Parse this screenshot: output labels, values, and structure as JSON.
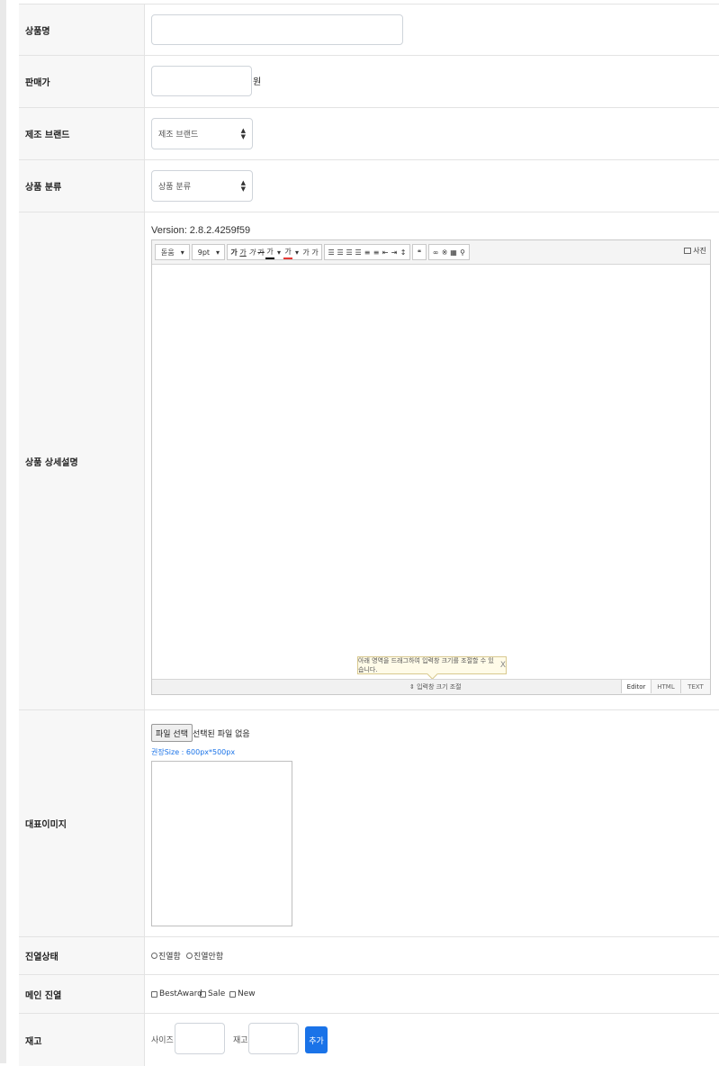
{
  "form": {
    "product_name": {
      "label": "상품명",
      "value": ""
    },
    "price": {
      "label": "판매가",
      "value": "",
      "unit": "원"
    },
    "brand": {
      "label": "제조 브랜드",
      "selected": "제조 브랜드"
    },
    "category": {
      "label": "상품 분류",
      "selected": "상품 분류"
    },
    "description": {
      "label": "상품 상세설명",
      "version": "Version: 2.8.2.4259f59",
      "toolbar": {
        "font": "돋움",
        "size": "9pt",
        "bold": "가",
        "underline": "가",
        "italic": "가",
        "strike": "가",
        "text_color": "가",
        "bg_color": "가",
        "superscript": "가",
        "subscript": "가",
        "quote": "❝",
        "photo": "사진"
      },
      "resize_tip": "아래 영역을 드래그하여 입력창 크기를 조절할 수 있습니다.",
      "resize_tip_close": "X",
      "resize_label": "⇕ 입력창 크기 조절",
      "modes": [
        "Editor",
        "HTML",
        "TEXT"
      ]
    },
    "image": {
      "label": "대표이미지",
      "button": "파일 선택",
      "status": "선택된 파일 없음",
      "size_note": "권장Size : 600px*500px"
    },
    "display": {
      "label": "진열상태",
      "options": [
        "진열함",
        "진열안함"
      ]
    },
    "main_display": {
      "label": "메인 진열",
      "options": [
        "BestAward",
        "Sale",
        "New"
      ]
    },
    "stock": {
      "label": "재고",
      "size_label": "사이즈",
      "stock_label": "재고",
      "add_button": "추가"
    }
  }
}
